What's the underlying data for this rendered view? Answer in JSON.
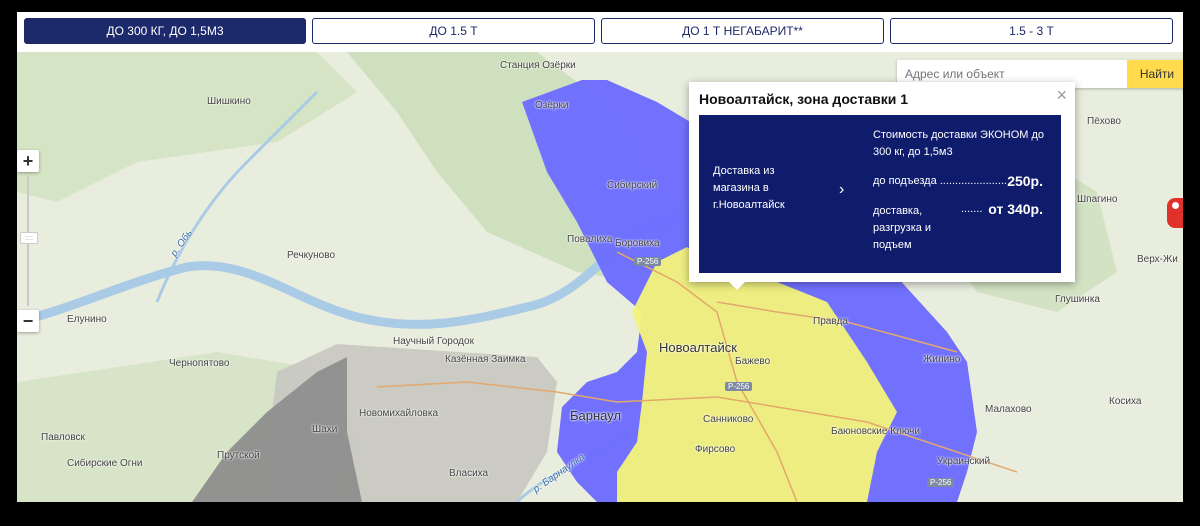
{
  "tabs": [
    {
      "label": "ДО 300 КГ, ДО 1,5М3",
      "active": true
    },
    {
      "label": "ДО 1.5 Т",
      "active": false
    },
    {
      "label": "ДО 1 Т НЕГАБАРИТ**",
      "active": false
    },
    {
      "label": "1.5 - 3 Т",
      "active": false
    }
  ],
  "search": {
    "placeholder": "Адрес или объект",
    "button": "Найти"
  },
  "zoom": {
    "plus": "+",
    "minus": "−",
    "handle": "::::"
  },
  "popup": {
    "title": "Новоалтайск, зона доставки 1",
    "close": "×",
    "left_text": "Доставка из магазина в г.Новоалтайск",
    "arrow": "›",
    "header": "Стоимость доставки ЭКОНОМ до 300 кг, до 1,5м3",
    "rows": [
      {
        "label": "до подъезда ......................",
        "value": "250р."
      },
      {
        "label": "доставка, разгрузка и подъем",
        "dots": ".......",
        "value": "от 340р."
      }
    ]
  },
  "map": {
    "colors": {
      "background": "#e9edde",
      "forest": "#cfe0bf",
      "river": "#a9cbe6",
      "blue_zone": "#6a6aff",
      "yellow_zone": "#f3f37a",
      "gray_zone": "#8a8a8a",
      "light_gray_zone": "#bdbdbd"
    },
    "labels": {
      "ozerki_station": "Станция Озёрки",
      "ozerki": "Озёрки",
      "shishkino": "Шишкино",
      "sibirsky": "Сибирский",
      "povalikha": "Повалиха",
      "borovikha": "Боровиха",
      "river_ob": "р. Обь",
      "rechkunovo": "Речкуново",
      "elunino": "Елунино",
      "novoaltaysk": "Новоалтайск",
      "pravda": "Правда",
      "bazhevo": "Бажево",
      "nauchny_gorodok": "Научный Городок",
      "kazennaya_zaimka": "Казённая Заимка",
      "chernopyatovo": "Чернопятово",
      "novomikhaylovka": "Новомихайловка",
      "barnaul": "Барнаул",
      "shakhi": "Шахи",
      "pavlovsk": "Павловск",
      "sibirskie_ogni": "Сибирские Огни",
      "prutskoy": "Прутской",
      "vlasikha": "Власиха",
      "river_barnaulka": "р. Барнаулка",
      "firsovo": "Фирсово",
      "sannikovo": "Санниково",
      "bayunovskie_klyuchi": "Баюновские Ключи",
      "zhilino": "Жилино",
      "malakhovo": "Малахово",
      "kosikha": "Косиха",
      "ukrainsky": "Украинский",
      "glushinka": "Глушинка",
      "verkh_zh": "Верх-Жи",
      "shpagino": "Шпагино",
      "zakharovo": "Пёхово",
      "road_r256": "Р-256"
    }
  }
}
